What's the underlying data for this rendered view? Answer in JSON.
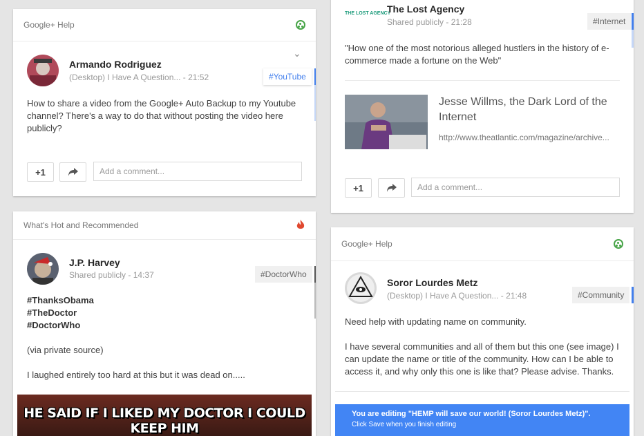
{
  "card1": {
    "header": "Google+ Help",
    "author": "Armando Rodriguez",
    "source": "(Desktop) I Have A Question...",
    "time": "21:52",
    "hashtag": "#YouTube",
    "body": "How to share a video from the Google+ Auto Backup to my Youtube channel? There's a way to do that without posting the video here publicly?",
    "plus_one": "+1",
    "comment_placeholder": "Add a comment..."
  },
  "card2": {
    "header": "What's Hot and Recommended",
    "author": "J.P. Harvey",
    "source": "Shared publicly",
    "time": "14:37",
    "hashtag": "#DoctorWho",
    "tags": [
      "#ThanksObama",
      "#TheDoctor",
      "#DoctorWho"
    ],
    "via": "(via private source)",
    "body": "I laughed entirely too hard at this but it was dead on.....",
    "meme_text": "HE SAID IF I LIKED MY DOCTOR I COULD KEEP HIM"
  },
  "card3": {
    "logo_text": "THE LOST AGENCY",
    "author": "The Lost Agency",
    "source": "Shared publicly",
    "time": "21:28",
    "hashtag": "#Internet",
    "quote": "\"How one of the most notorious alleged hustlers in the history of e-commerce made a fortune on the Web\"",
    "link_title": "Jesse Willms, the Dark Lord of the Internet",
    "link_url": "http://www.theatlantic.com/magazine/archive...",
    "plus_one": "+1",
    "comment_placeholder": "Add a comment..."
  },
  "card4": {
    "header": "Google+ Help",
    "author": "Soror Lourdes Metz",
    "source": "(Desktop) I Have A Question...",
    "time": "21:48",
    "hashtag": "#Community",
    "body1": "Need help with updating name on community.",
    "body2": "I have several communities and all of them but this one (see image) I can update the name or title of the community. How can I be able to access it, and why only this one is like that? Please advise. Thanks.",
    "banner_title": "You are editing \"HEMP will save our world! (Soror Lourdes Metz)\".",
    "banner_sub": "Click Save when you finish editing"
  },
  "colors": {
    "accent": "#427fed",
    "community_green": "#47a447",
    "hot_red": "#e0482f"
  }
}
